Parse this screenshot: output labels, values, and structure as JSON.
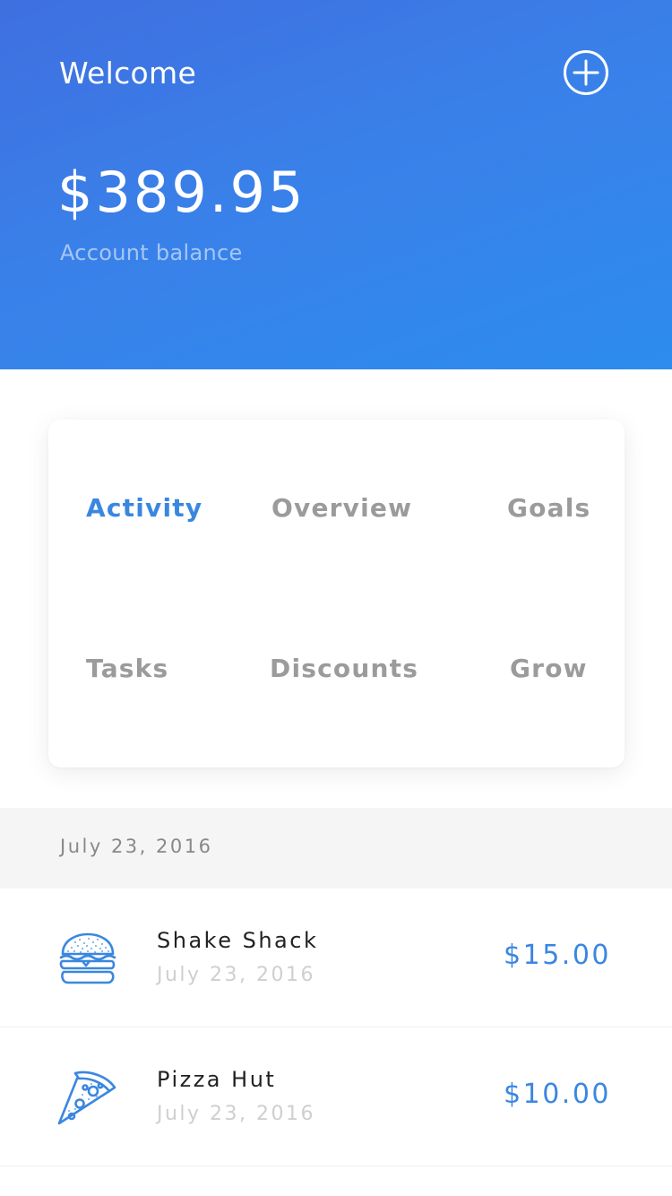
{
  "header": {
    "welcome": "Welcome",
    "balance": "$389.95",
    "balance_label": "Account balance",
    "add_icon": "plus-circle-icon"
  },
  "menu": {
    "items": [
      {
        "label": "Activity",
        "active": true
      },
      {
        "label": "Overview",
        "active": false
      },
      {
        "label": "Goals",
        "active": false
      },
      {
        "label": "Tasks",
        "active": false
      },
      {
        "label": "Discounts",
        "active": false
      },
      {
        "label": "Grow",
        "active": false
      }
    ]
  },
  "date_section": {
    "label": "July 23, 2016"
  },
  "transactions": [
    {
      "name": "Shake Shack",
      "date": "July 23, 2016",
      "amount": "$15.00",
      "icon": "burger-icon"
    },
    {
      "name": "Pizza Hut",
      "date": "July 23, 2016",
      "amount": "$10.00",
      "icon": "pizza-slice-icon"
    }
  ],
  "colors": {
    "header_gradient_start": "#3f6fe0",
    "header_gradient_end": "#2d8cee",
    "accent": "#3a87e0",
    "inactive_menu": "#9b9b9b",
    "band_background": "#f5f5f5"
  }
}
